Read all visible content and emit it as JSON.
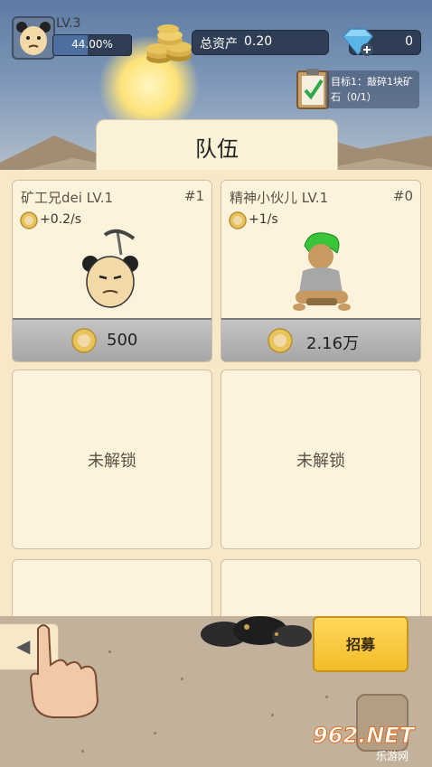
{
  "player": {
    "level": "LV.3",
    "progress": "44.00%",
    "progress_fraction": 0.44
  },
  "assets": {
    "label": "总资产",
    "value": "0.20"
  },
  "gems": {
    "value": "0"
  },
  "goal": {
    "text": "目标1：敲碎1块矿石（0/1）"
  },
  "panel": {
    "title": "队伍"
  },
  "cards": [
    {
      "name": "矿工兄dei LV.1",
      "number": "#1",
      "rate": "+0.2/s",
      "price": "500"
    },
    {
      "name": "精神小伙儿 LV.1",
      "number": "#0",
      "rate": "+1/s",
      "price": "2.16万"
    }
  ],
  "locked": [
    {
      "label": "未解锁"
    },
    {
      "label": "未解锁"
    }
  ],
  "recruit": {
    "label": "招募"
  },
  "watermark": {
    "logo": "962.NET",
    "sub": "乐游网"
  },
  "icons": {
    "avatar": "panda-face-avatar",
    "coins": "coin-stack-icon",
    "gem": "diamond-plus-icon",
    "goal": "clipboard-check-icon",
    "back": "back-arrow-icon",
    "hand": "pointing-hand-icon"
  },
  "colors": {
    "hud_dark": "#2f3e55",
    "panel_bg": "#f7e9c8",
    "recruit_yellow": "#f2bc2a"
  }
}
